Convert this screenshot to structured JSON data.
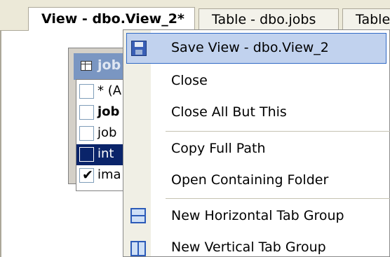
{
  "tabs": [
    {
      "label": "View - dbo.View_2*",
      "active": true
    },
    {
      "label": "Table - dbo.jobs",
      "active": false
    },
    {
      "label": "Table",
      "active": false
    }
  ],
  "designer": {
    "table_title": "job",
    "columns": [
      {
        "label": "* (A",
        "checked": false,
        "selected": false
      },
      {
        "label": "job",
        "checked": false,
        "selected": false,
        "bold": true
      },
      {
        "label": "job",
        "checked": false,
        "selected": false
      },
      {
        "label": "int",
        "checked": false,
        "selected": true
      },
      {
        "label": "ima",
        "checked": true,
        "selected": false
      }
    ]
  },
  "context_menu": {
    "items": [
      {
        "label": "Save View - dbo.View_2",
        "icon": "save-icon",
        "highlighted": true
      },
      {
        "label": "Close",
        "icon": null
      },
      {
        "label": "Close All But This",
        "icon": null
      },
      {
        "label": "Copy Full Path",
        "icon": null
      },
      {
        "label": "Open Containing Folder",
        "icon": null
      },
      {
        "label": "New Horizontal Tab Group",
        "icon": "horizontal-tab-group-icon"
      },
      {
        "label": "New Vertical Tab Group",
        "icon": "vertical-tab-group-icon"
      }
    ]
  },
  "colors": {
    "selection_highlight": "#c1d2ee",
    "selection_border": "#316ac5",
    "selected_row": "#0a246a",
    "table_header": "#7a96c2"
  }
}
